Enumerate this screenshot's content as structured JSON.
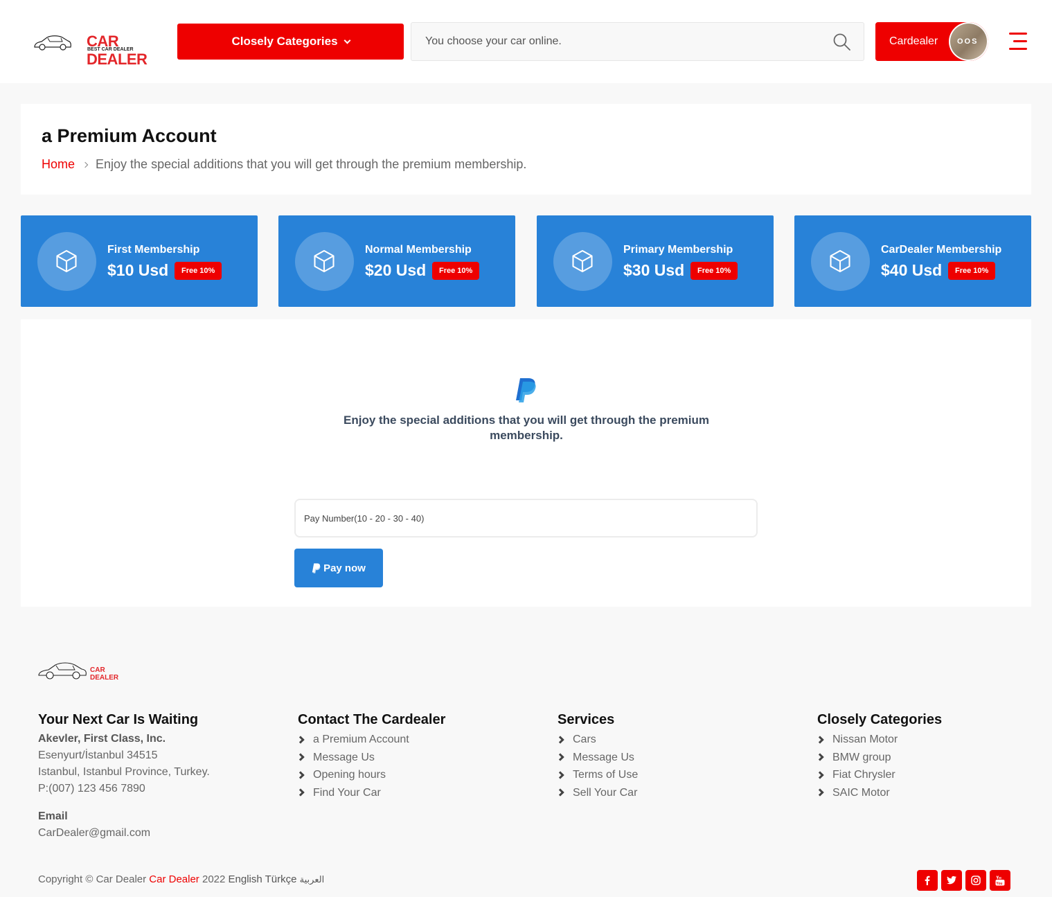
{
  "header": {
    "logo_brand": "CAR DEALER",
    "logo_sub": "BEST CAR DEALER",
    "categories_label": "Closely Categories",
    "search_placeholder": "You choose your car online.",
    "user_label": "Cardealer",
    "avatar_text": "OOS"
  },
  "title_block": {
    "title": "a Premium Account",
    "breadcrumb_home": "Home",
    "breadcrumb_current": "Enjoy the special additions that you will get through the premium membership."
  },
  "plans": [
    {
      "name": "First Membership",
      "price": "$10 Usd",
      "badge": "Free 10%"
    },
    {
      "name": "Normal Membership",
      "price": "$20 Usd",
      "badge": "Free 10%"
    },
    {
      "name": "Primary Membership",
      "price": "$30 Usd",
      "badge": "Free 10%"
    },
    {
      "name": "CarDealer Membership",
      "price": "$40 Usd",
      "badge": "Free 10%"
    }
  ],
  "payment": {
    "heading": "Enjoy the special additions that you will get through the premium membership.",
    "input_placeholder": "Pay Number(10 - 20 - 30 - 40)",
    "button_label": "Pay now"
  },
  "footer": {
    "logo_brand": "CAR DEALER",
    "col1": {
      "title": "Your Next Car Is Waiting",
      "company": "Akevler, First Class, Inc.",
      "line1": "Esenyurt/İstanbul 34515",
      "line2": "Istanbul, Istanbul Province, Turkey.",
      "phone": "P:(007) 123 456 7890",
      "email_label": "Email",
      "email": "CarDealer@gmail.com"
    },
    "col2": {
      "title": "Contact The Cardealer",
      "links": [
        "a Premium Account",
        "Message Us",
        "Opening hours",
        "Find Your Car"
      ]
    },
    "col3": {
      "title": "Services",
      "links": [
        "Cars",
        "Message Us",
        "Terms of Use",
        "Sell Your Car"
      ]
    },
    "col4": {
      "title": "Closely Categories",
      "links": [
        "Nissan Motor",
        "BMW group",
        "Fiat Chrysler",
        "SAIC Motor"
      ]
    },
    "copyright_prefix": "Copyright © Car Dealer",
    "copyright_brand": "Car Dealer",
    "copyright_year": "2022",
    "languages": [
      "English",
      "Türkçe",
      "العربية"
    ],
    "social": [
      "facebook-icon",
      "twitter-icon",
      "instagram-icon",
      "youtube-icon"
    ]
  },
  "colors": {
    "accent_red": "#ee0000",
    "plan_blue": "#2882d8",
    "background": "#f8f8f8"
  }
}
